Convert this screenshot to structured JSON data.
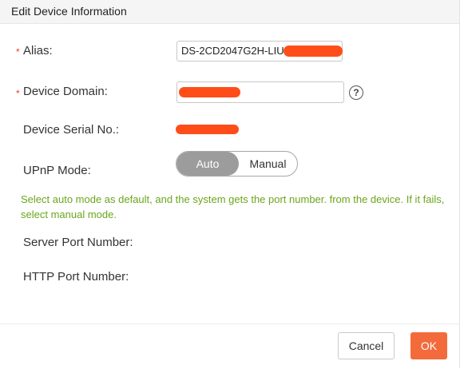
{
  "dialog": {
    "title": "Edit Device Information"
  },
  "form": {
    "required_mark": "*",
    "alias_label": "Alias:",
    "alias_value": "DS-2CD2047G2H-LIU",
    "domain_label": "Device Domain:",
    "help_icon": "question-circle-icon",
    "serial_label": "Device Serial No.:",
    "upnp_label": "UPnP Mode:",
    "upnp_options": [
      "Auto",
      "Manual"
    ],
    "upnp_selected": "Auto",
    "hint": "Select auto mode as default, and the system gets the port number. from the device. If it fails, select manual mode.",
    "server_port_label": "Server Port Number:",
    "http_port_label": "HTTP Port Number:"
  },
  "footer": {
    "cancel_label": "Cancel",
    "ok_label": "OK"
  },
  "colors": {
    "accent": "#f36b3b",
    "hint_text": "#6aa61c",
    "required": "#e8431c",
    "toggle_selected": "#9c9c9c",
    "redaction": "#ff4d1a"
  }
}
